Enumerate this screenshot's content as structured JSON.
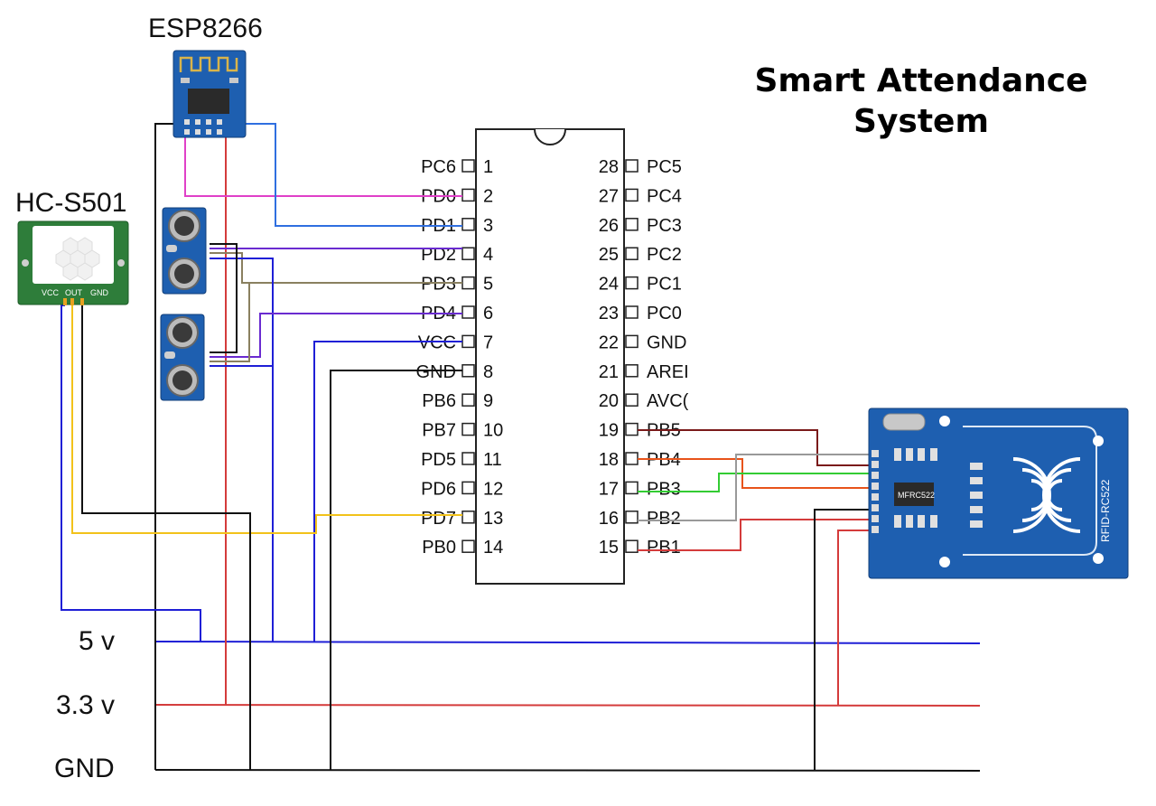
{
  "title": {
    "line1": "Smart Attendance",
    "line2": "System"
  },
  "modules": {
    "esp": "ESP8266",
    "pir": "HC-S501",
    "pir_pins": [
      "VCC",
      "OUT",
      "GND"
    ],
    "rfid": "RFID-RC522",
    "rfid_chip": "MFRC522"
  },
  "rails": [
    {
      "label": "5 v",
      "color": "#1f1fd6"
    },
    {
      "label": "3.3 v",
      "color": "#d43b3b"
    },
    {
      "label": "GND",
      "color": "#111111"
    }
  ],
  "ic": {
    "left_pins": [
      {
        "num": "1",
        "name": "PC6"
      },
      {
        "num": "2",
        "name": "PD0"
      },
      {
        "num": "3",
        "name": "PD1"
      },
      {
        "num": "4",
        "name": "PD2"
      },
      {
        "num": "5",
        "name": "PD3"
      },
      {
        "num": "6",
        "name": "PD4"
      },
      {
        "num": "7",
        "name": "VCC"
      },
      {
        "num": "8",
        "name": "GND"
      },
      {
        "num": "9",
        "name": "PB6"
      },
      {
        "num": "10",
        "name": "PB7"
      },
      {
        "num": "11",
        "name": "PD5"
      },
      {
        "num": "12",
        "name": "PD6"
      },
      {
        "num": "13",
        "name": "PD7"
      },
      {
        "num": "14",
        "name": "PB0"
      }
    ],
    "right_pins": [
      {
        "num": "28",
        "name": "PC5"
      },
      {
        "num": "27",
        "name": "PC4"
      },
      {
        "num": "26",
        "name": "PC3"
      },
      {
        "num": "25",
        "name": "PC2"
      },
      {
        "num": "24",
        "name": "PC1"
      },
      {
        "num": "23",
        "name": "PC0"
      },
      {
        "num": "22",
        "name": "GND"
      },
      {
        "num": "21",
        "name": "AREI"
      },
      {
        "num": "20",
        "name": "AVC("
      },
      {
        "num": "19",
        "name": "PB5"
      },
      {
        "num": "18",
        "name": "PB4"
      },
      {
        "num": "17",
        "name": "PB3"
      },
      {
        "num": "16",
        "name": "PB2"
      },
      {
        "num": "15",
        "name": "PB1"
      }
    ]
  },
  "wire_colors": {
    "magenta": "#e040c8",
    "blue_light": "#2f6fe0",
    "purple": "#6a2bd0",
    "olive": "#8a8060",
    "yellow": "#f2c21a",
    "maroon": "#7a1a1a",
    "orange": "#e8531a",
    "green": "#33cc33",
    "gray": "#999999",
    "board_blue": "#1e5fb0"
  }
}
